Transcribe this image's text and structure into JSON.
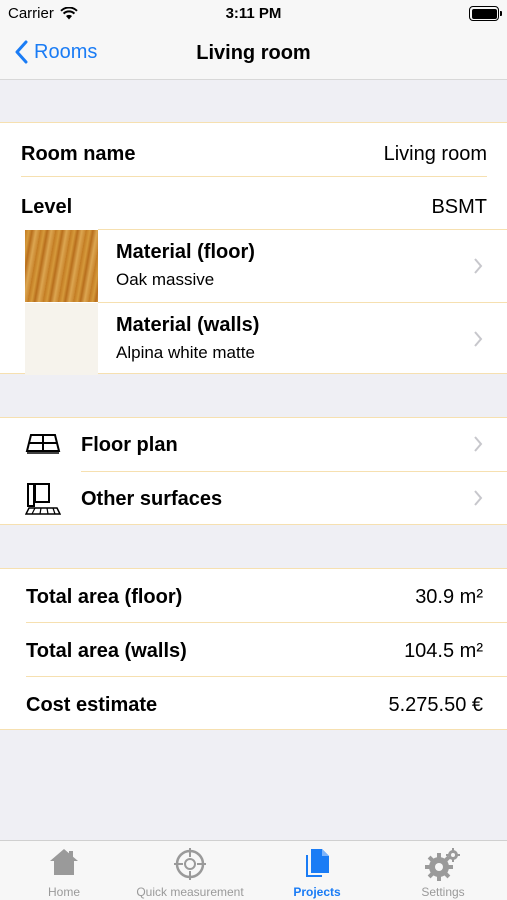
{
  "status": {
    "carrier": "Carrier",
    "time": "3:11 PM"
  },
  "nav": {
    "back_label": "Rooms",
    "title": "Living room"
  },
  "room": {
    "name_label": "Room name",
    "name_value": "Living room",
    "level_label": "Level",
    "level_value": "BSMT",
    "materials": [
      {
        "label": "Material (floor)",
        "value": "Oak massive"
      },
      {
        "label": "Material (walls)",
        "value": "Alpina white matte"
      }
    ]
  },
  "links": [
    {
      "label": "Floor plan",
      "icon": "floor-plan-icon"
    },
    {
      "label": "Other surfaces",
      "icon": "other-surfaces-icon"
    }
  ],
  "totals": [
    {
      "label": "Total area (floor)",
      "value": "30.9 m²"
    },
    {
      "label": "Total area (walls)",
      "value": "104.5 m²"
    },
    {
      "label": "Cost estimate",
      "value": "5.275.50 €"
    }
  ],
  "tabs": [
    {
      "label": "Home",
      "icon": "home-icon"
    },
    {
      "label": "Quick measurement",
      "icon": "crosshair-icon"
    },
    {
      "label": "Projects",
      "icon": "projects-icon",
      "active": true
    },
    {
      "label": "Settings",
      "icon": "gear-icon"
    }
  ],
  "colors": {
    "accent": "#1a7cf5",
    "separator": "#f6e0b0",
    "background": "#efeff4"
  }
}
